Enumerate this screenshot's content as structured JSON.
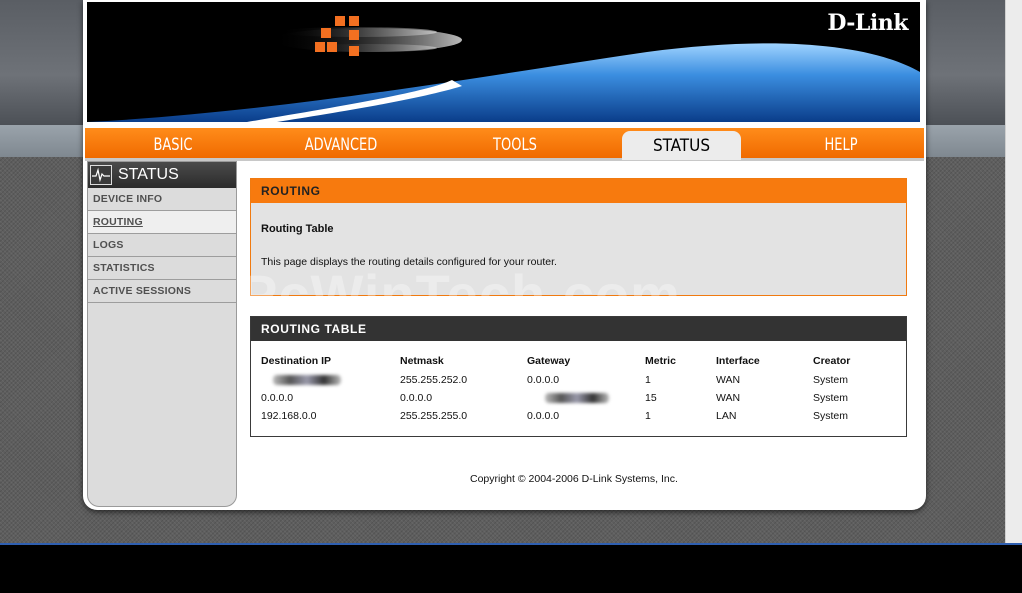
{
  "brand": {
    "logo_text": "D-Link"
  },
  "tabs": [
    {
      "label": "BASIC"
    },
    {
      "label": "ADVANCED"
    },
    {
      "label": "TOOLS"
    },
    {
      "label": "STATUS",
      "active": true
    },
    {
      "label": "HELP"
    }
  ],
  "sidebar": {
    "title": "STATUS",
    "items": [
      {
        "label": "DEVICE INFO"
      },
      {
        "label": "ROUTING",
        "active": true
      },
      {
        "label": "LOGS"
      },
      {
        "label": "STATISTICS"
      },
      {
        "label": "ACTIVE SESSIONS"
      }
    ]
  },
  "routing_section": {
    "title": "ROUTING",
    "subheading": "Routing Table",
    "description": "This page displays the routing details configured for your router."
  },
  "routing_table": {
    "title": "ROUTING TABLE",
    "columns": [
      "Destination IP",
      "Netmask",
      "Gateway",
      "Metric",
      "Interface",
      "Creator"
    ],
    "rows": [
      [
        "",
        "255.255.252.0",
        "0.0.0.0",
        "1",
        "WAN",
        "System"
      ],
      [
        "0.0.0.0",
        "0.0.0.0",
        "",
        "15",
        "WAN",
        "System"
      ],
      [
        "192.168.0.0",
        "255.255.255.0",
        "0.0.0.0",
        "1",
        "LAN",
        "System"
      ]
    ]
  },
  "footer": {
    "copyright": "Copyright © 2004-2006 D-Link Systems, Inc."
  },
  "watermark": "PcWinTech.com",
  "colors": {
    "accent": "#f77a0e",
    "dark_header": "#333333"
  }
}
